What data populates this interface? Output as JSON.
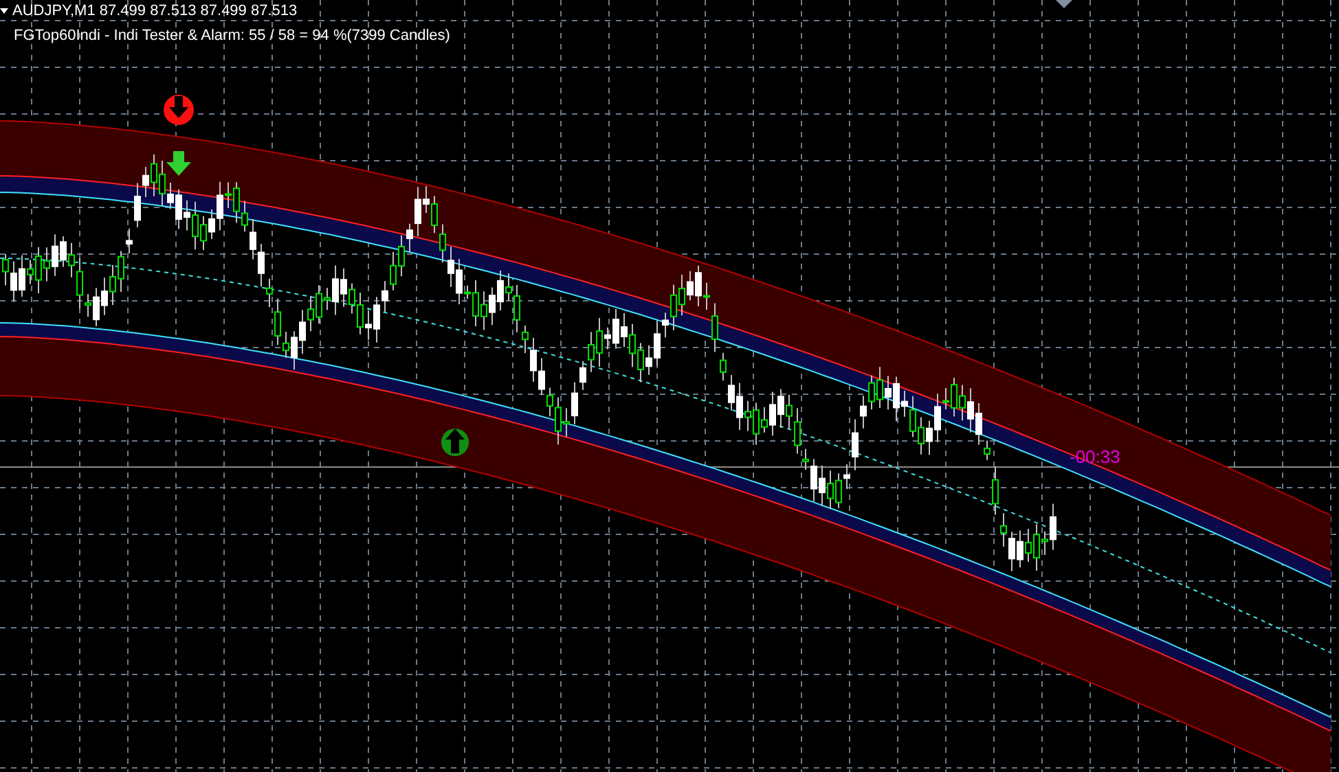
{
  "chart": {
    "symbol_line": "AUDJPY,M1  87.499 87.513 87.499 87.513",
    "indicator_text": "FGTop60Indi - Indi Tester & Alarm: 55 / 58 = 94 %(7399 Candles)",
    "timer": "-00:33"
  }
}
